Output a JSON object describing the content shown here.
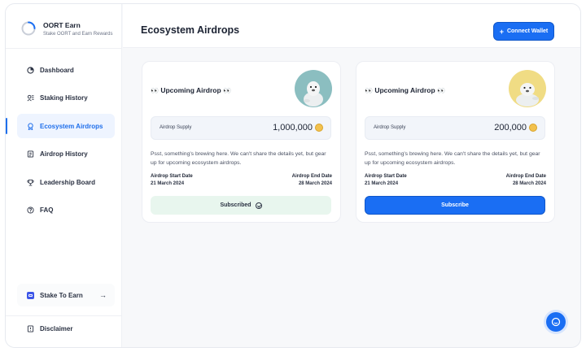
{
  "app": {
    "name": "OORT Earn",
    "tagline": "Stake OORT and Earn Rewards"
  },
  "sidebar": {
    "items": [
      {
        "label": "Dashboard",
        "icon": "dashboard-icon"
      },
      {
        "label": "Staking History",
        "icon": "staking-history-icon"
      },
      {
        "label": "Ecosystem Airdrops",
        "icon": "airdrop-icon",
        "active": true
      },
      {
        "label": "Airdrop History",
        "icon": "airdrop-history-icon"
      },
      {
        "label": "Leadership Board",
        "icon": "trophy-icon"
      },
      {
        "label": "FAQ",
        "icon": "question-icon"
      }
    ],
    "stake_label": "Stake To Earn",
    "stake_arrow": "→",
    "disclaimer_label": "Disclaimer"
  },
  "header": {
    "title": "Ecosystem Airdrops",
    "connect_label": "Connect Wallet",
    "connect_plus": "+"
  },
  "cards": [
    {
      "title": "Upcoming Airdrop",
      "supply_label": "Airdrop Supply",
      "supply_value": "1,000,000",
      "description": "Psst, something's brewing here. We can't share the details yet, but gear up for upcoming ecosystem airdrops.",
      "start_label": "Airdrop Start Date",
      "start_value": "21 March 2024",
      "end_label": "Airdrop End Date",
      "end_value": "28 March 2024",
      "button_label": "Subscribed",
      "avatar_color": "#8bbec0"
    },
    {
      "title": "Upcoming Airdrop",
      "supply_label": "Airdrop Supply",
      "supply_value": "200,000",
      "description": "Psst, something's brewing here. We can't share the details yet, but gear up for upcoming ecosystem airdrops.",
      "start_label": "Airdrop Start Date",
      "start_value": "21 March 2024",
      "end_label": "Airdrop End Date",
      "end_value": "28 March 2024",
      "button_label": "Subscribe",
      "avatar_color": "#f0dc84"
    }
  ],
  "colors": {
    "accent": "#1a6ef3",
    "subscribed_bg": "#e8f6ee",
    "active_bg": "#eef4ff"
  }
}
